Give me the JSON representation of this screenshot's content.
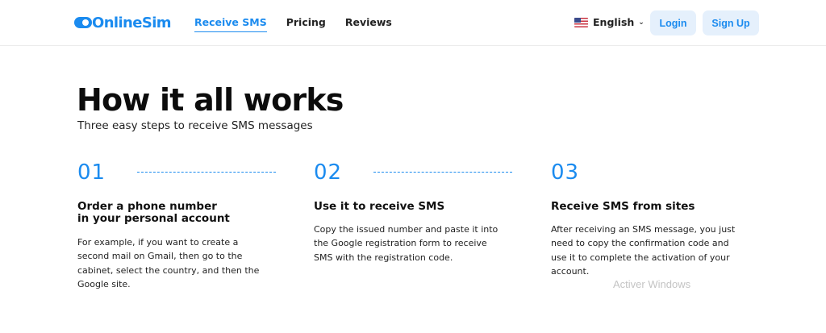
{
  "header": {
    "logo_text": "OnlineSim",
    "nav": [
      {
        "label": "Receive SMS",
        "active": true
      },
      {
        "label": "Pricing",
        "active": false
      },
      {
        "label": "Reviews",
        "active": false
      }
    ],
    "language": "English",
    "login_label": "Login",
    "signup_label": "Sign Up"
  },
  "hero": {
    "title": "How it all works",
    "subtitle": "Three easy steps to receive SMS messages"
  },
  "steps": [
    {
      "number": "01",
      "title_line1": "Order a phone number",
      "title_line2": "in your personal account",
      "text": "For example, if you want to create a second mail on Gmail, then go to the cabinet, select the country, and then the Google site."
    },
    {
      "number": "02",
      "title_line1": "Use it to receive SMS",
      "title_line2": "",
      "text": "Copy the issued number and paste it into the Google registration form to receive SMS with the registration code."
    },
    {
      "number": "03",
      "title_line1": "Receive SMS from sites",
      "title_line2": "",
      "text": "After receiving an SMS message, you just need to copy the confirmation code and use it to complete the activation of your account."
    }
  ],
  "colors": {
    "accent": "#1b8bef",
    "button_bg": "#e5f0fc"
  },
  "os_watermark": "Activer Windows"
}
